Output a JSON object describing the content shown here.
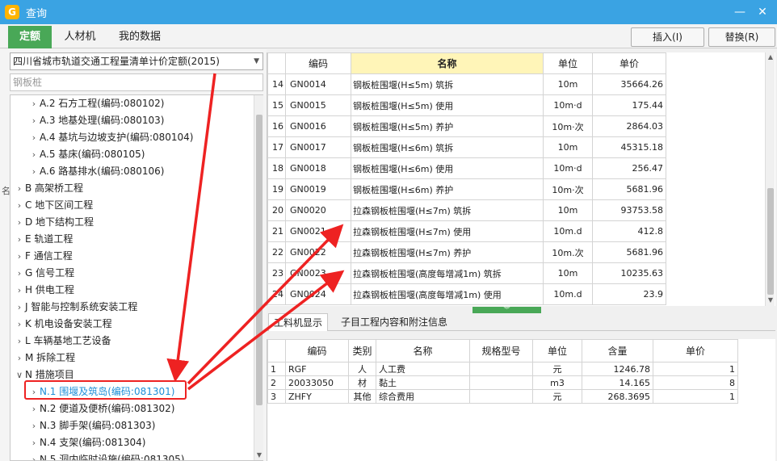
{
  "window": {
    "title": "查询",
    "logo_glyph": "G",
    "minimize_glyph": "—",
    "close_glyph": "✕"
  },
  "tabs": [
    {
      "label": "定额"
    },
    {
      "label": "人材机"
    },
    {
      "label": "我的数据"
    }
  ],
  "buttons": {
    "insert": "插入(I)",
    "replace": "替换(R)"
  },
  "library": {
    "selected": "四川省城市轨道交通工程量清单计价定额(2015)"
  },
  "search": {
    "value": "钢板桩"
  },
  "side_label": "名",
  "tree": [
    {
      "label": "A.2 石方工程(编码:080102)",
      "level": 2
    },
    {
      "label": "A.3 地基处理(编码:080103)",
      "level": 2
    },
    {
      "label": "A.4 基坑与边坡支护(编码:080104)",
      "level": 2
    },
    {
      "label": "A.5 基床(编码:080105)",
      "level": 2
    },
    {
      "label": "A.6 路基排水(编码:080106)",
      "level": 2
    },
    {
      "label": "B 高架桥工程",
      "level": 1
    },
    {
      "label": "C 地下区间工程",
      "level": 1
    },
    {
      "label": "D 地下结构工程",
      "level": 1
    },
    {
      "label": "E 轨道工程",
      "level": 1
    },
    {
      "label": "F 通信工程",
      "level": 1
    },
    {
      "label": "G 信号工程",
      "level": 1
    },
    {
      "label": "H 供电工程",
      "level": 1
    },
    {
      "label": "J 智能与控制系统安装工程",
      "level": 1
    },
    {
      "label": "K 机电设备安装工程",
      "level": 1
    },
    {
      "label": "L 车辆基地工艺设备",
      "level": 1
    },
    {
      "label": "M 拆除工程",
      "level": 1
    },
    {
      "label": "N 措施项目",
      "level": 1,
      "expanded": true
    },
    {
      "label": "N.1 围堰及筑岛(编码:081301)",
      "level": 2,
      "selected": true
    },
    {
      "label": "N.2 便道及便桥(编码:081302)",
      "level": 2
    },
    {
      "label": "N.3 脚手架(编码:081303)",
      "level": 2
    },
    {
      "label": "N.4 支架(编码:081304)",
      "level": 2
    },
    {
      "label": "N.5 洞内临时设施(编码:081305)",
      "level": 2
    }
  ],
  "quota_table": {
    "headers": [
      "",
      "编码",
      "名称",
      "单位",
      "单价"
    ],
    "rows": [
      {
        "no": "14",
        "code": "GN0014",
        "name": "钢板桩围堰(H≤5m) 筑拆",
        "unit": "10m",
        "price": "35664.26"
      },
      {
        "no": "15",
        "code": "GN0015",
        "name": "钢板桩围堰(H≤5m) 使用",
        "unit": "10m·d",
        "price": "175.44"
      },
      {
        "no": "16",
        "code": "GN0016",
        "name": "钢板桩围堰(H≤5m) 养护",
        "unit": "10m·次",
        "price": "2864.03"
      },
      {
        "no": "17",
        "code": "GN0017",
        "name": "钢板桩围堰(H≤6m) 筑拆",
        "unit": "10m",
        "price": "45315.18"
      },
      {
        "no": "18",
        "code": "GN0018",
        "name": "钢板桩围堰(H≤6m) 使用",
        "unit": "10m·d",
        "price": "256.47"
      },
      {
        "no": "19",
        "code": "GN0019",
        "name": "钢板桩围堰(H≤6m) 养护",
        "unit": "10m·次",
        "price": "5681.96"
      },
      {
        "no": "20",
        "code": "GN0020",
        "name": "拉森钢板桩围堰(H≤7m) 筑拆",
        "unit": "10m",
        "price": "93753.58"
      },
      {
        "no": "21",
        "code": "GN0021",
        "name": "拉森钢板桩围堰(H≤7m) 使用",
        "unit": "10m.d",
        "price": "412.8"
      },
      {
        "no": "22",
        "code": "GN0022",
        "name": "拉森钢板桩围堰(H≤7m) 养护",
        "unit": "10m.次",
        "price": "5681.96"
      },
      {
        "no": "23",
        "code": "GN0023",
        "name": "拉森钢板桩围堰(高度每增减1m) 筑拆",
        "unit": "10m",
        "price": "10235.63"
      },
      {
        "no": "24",
        "code": "GN0024",
        "name": "拉森钢板桩围堰(高度每增减1m) 使用",
        "unit": "10m.d",
        "price": "23.9"
      }
    ]
  },
  "bottom_tabs": [
    {
      "label": "工料机显示"
    },
    {
      "label": "子目工程内容和附注信息"
    }
  ],
  "resource_table": {
    "headers": [
      "",
      "编码",
      "类别",
      "名称",
      "规格型号",
      "单位",
      "含量",
      "单价"
    ],
    "rows": [
      {
        "no": "1",
        "code": "RGF",
        "type": "人",
        "name": "人工费",
        "spec": "",
        "unit": "元",
        "qty": "1246.78",
        "price": "1"
      },
      {
        "no": "2",
        "code": "20033050",
        "type": "材",
        "name": "黏土",
        "spec": "",
        "unit": "m3",
        "qty": "14.165",
        "price": "8"
      },
      {
        "no": "3",
        "code": "ZHFY",
        "type": "其他",
        "name": "综合费用",
        "spec": "",
        "unit": "元",
        "qty": "268.3695",
        "price": "1"
      }
    ]
  },
  "colors": {
    "title_bar": "#3aa3e3",
    "active_tab": "#49a857",
    "highlight_header": "#fff5b8",
    "selected_item": "#1d8fd8",
    "annotation": "#ee2222"
  }
}
